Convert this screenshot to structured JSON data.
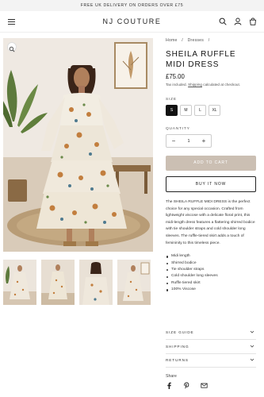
{
  "announcement": "FREE UK DELIVERY ON ORDERS OVER £75",
  "brand": "NJ COUTURE",
  "header_icons": [
    "menu-icon",
    "search-icon",
    "account-icon",
    "cart-icon"
  ],
  "breadcrumb": [
    "Home",
    "/",
    "Dresses",
    "/"
  ],
  "product": {
    "title": "SHEILA RUFFLE MIDI DRESS",
    "price": "£75.00",
    "tax_text": "Tax included.",
    "shipping_link": "Shipping",
    "tax_suffix": "calculated at checkout.",
    "size_label": "SIZE",
    "sizes": [
      "S",
      "M",
      "L",
      "XL"
    ],
    "selected_size": "S",
    "quantity_label": "QUANTITY",
    "quantity": "1",
    "minus": "−",
    "plus": "+",
    "add_to_cart": "ADD TO CART",
    "buy_now": "BUY IT NOW",
    "description": "The SHEILA RUFFLE MIDI DRESS is the perfect choice for any special occasion. Crafted from lightweight viscose with a delicate floral print, this midi-length dress features a flattering shirred bodice with tie shoulder straps and cold shoulder long sleeves. The ruffle-tiered skirt adds a touch of femininity to this timeless piece.",
    "features": [
      "Midi length",
      "Shirred bodice",
      "Tie shoulder straps",
      "Cold shoulder long sleeves",
      "Ruffle tiered skirt",
      "100% Viscose"
    ]
  },
  "accordions": [
    "SIZE GUIDE",
    "SHIPPING",
    "RETURNS"
  ],
  "share_label": "Share",
  "share_icons": [
    "facebook-icon",
    "pinterest-icon",
    "email-icon"
  ],
  "colors": {
    "cart_button": "#cbbfb3",
    "selected_size": "#111111",
    "announcement_bg": "#f3f3f3"
  }
}
